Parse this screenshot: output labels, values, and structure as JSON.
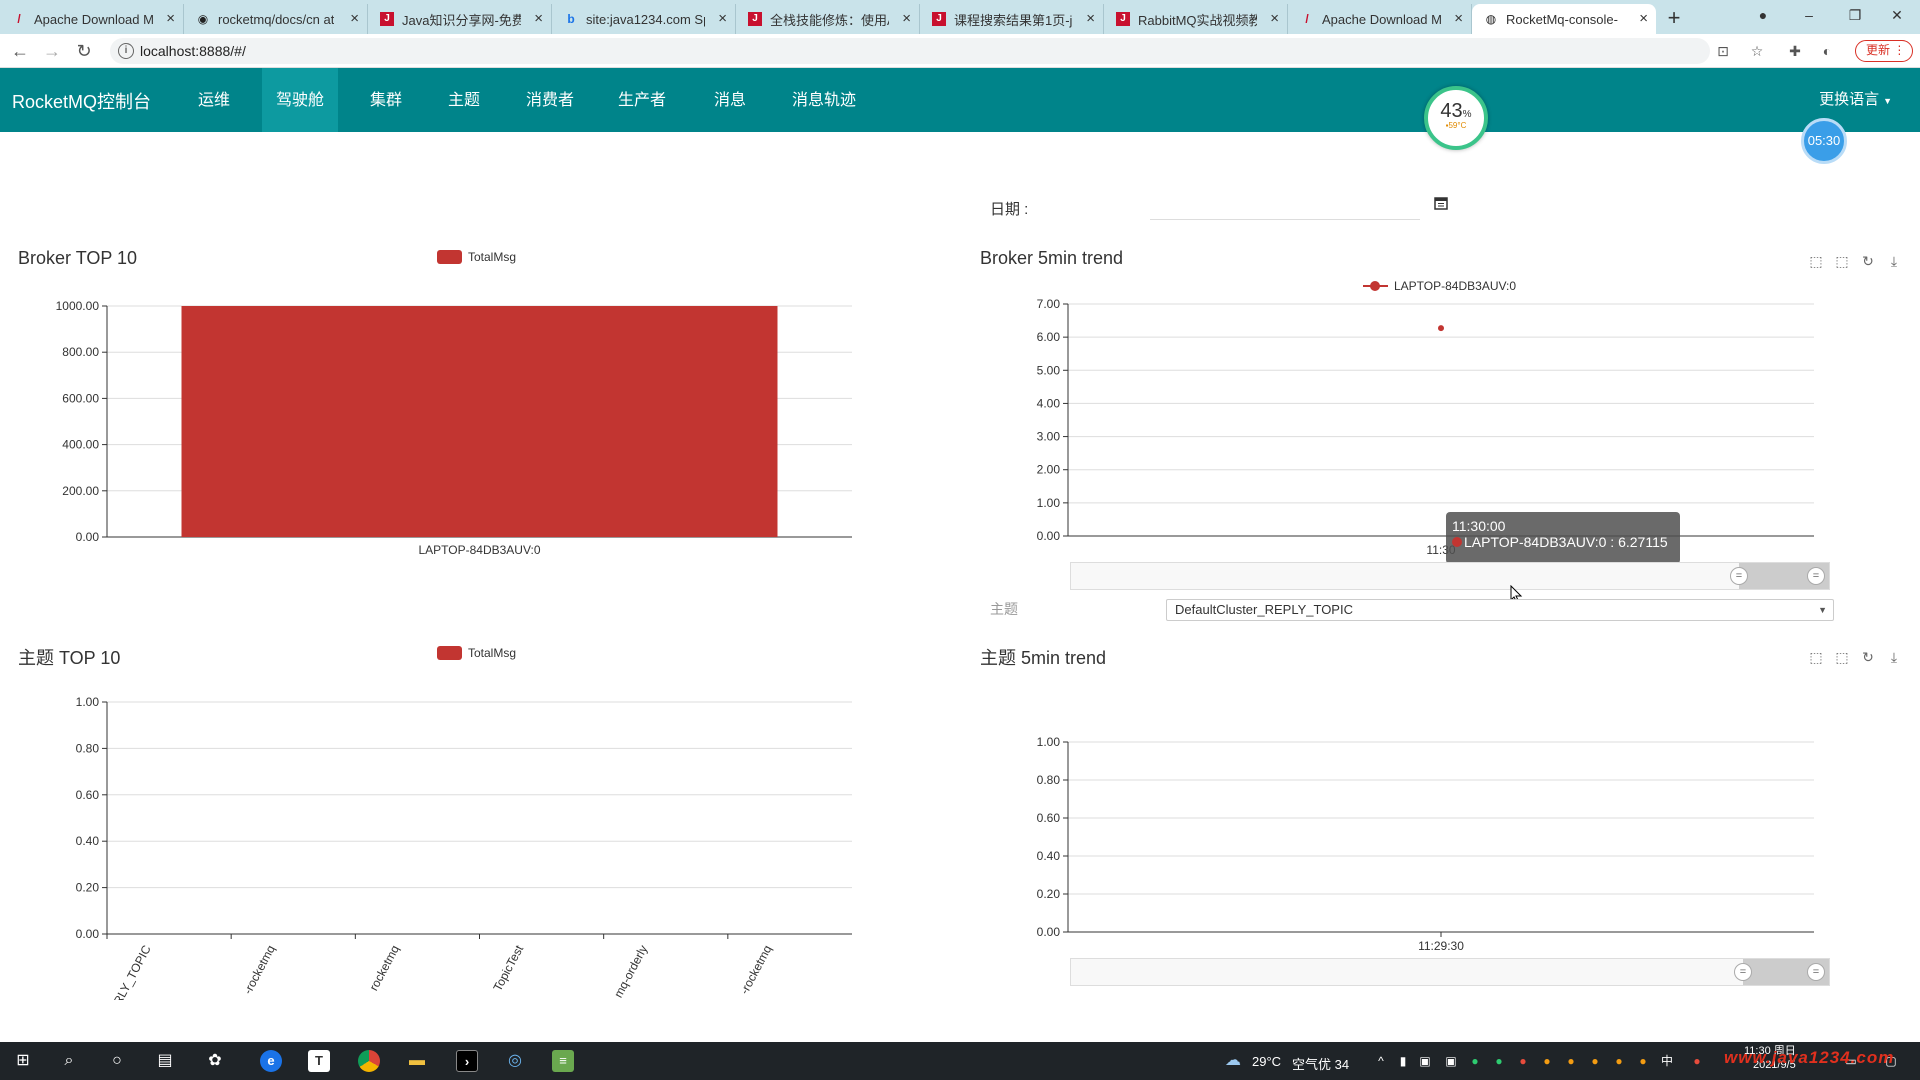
{
  "browser": {
    "tabs": [
      {
        "label": "Apache Download M",
        "icon": "feather-icon",
        "active": false
      },
      {
        "label": "rocketmq/docs/cn at",
        "icon": "github-icon",
        "active": false
      },
      {
        "label": "Java知识分享网-免费",
        "icon": "java1234-icon",
        "active": false
      },
      {
        "label": "site:java1234.com Sp",
        "icon": "bing-icon",
        "active": false
      },
      {
        "label": "全栈技能修炼：使用A",
        "icon": "java1234-icon",
        "active": false
      },
      {
        "label": "课程搜索结果第1页-ja",
        "icon": "java1234-icon",
        "active": false
      },
      {
        "label": "RabbitMQ实战视频教",
        "icon": "java1234-icon",
        "active": false
      },
      {
        "label": "Apache Download M",
        "icon": "feather-icon",
        "active": false
      },
      {
        "label": "RocketMq-console-",
        "icon": "globe-icon",
        "active": true
      }
    ],
    "url": "localhost:8888/#/",
    "update_label": "更新"
  },
  "app": {
    "brand": "RocketMQ控制台",
    "nav": [
      {
        "label": "运维",
        "active": false
      },
      {
        "label": "驾驶舱",
        "active": true
      },
      {
        "label": "集群",
        "active": false
      },
      {
        "label": "主题",
        "active": false
      },
      {
        "label": "消费者",
        "active": false
      },
      {
        "label": "生产者",
        "active": false
      },
      {
        "label": "消息",
        "active": false
      },
      {
        "label": "消息轨迹",
        "active": false
      }
    ],
    "language_label": "更换语言"
  },
  "overlay": {
    "perf_percent": "43",
    "perf_unit": "%",
    "perf_temp": "59°C",
    "clock_badge": "05:30"
  },
  "dashboard": {
    "date_label": "日期 :",
    "date_value": "",
    "topic_label": "主题",
    "topic_selected": "DefaultCluster_REPLY_TOPIC",
    "panels": {
      "broker_top": {
        "title": "Broker TOP 10",
        "legend": "TotalMsg"
      },
      "broker_trend": {
        "title": "Broker 5min trend",
        "legend": "LAPTOP-84DB3AUV:0"
      },
      "topic_top": {
        "title": "主题 TOP 10",
        "legend": "TotalMsg"
      },
      "topic_trend": {
        "title": "主题 5min trend"
      }
    },
    "tooltip": {
      "time": "11:30:00",
      "series": "LAPTOP-84DB3AUV:0",
      "value": "6.27115"
    }
  },
  "chart_data": [
    {
      "type": "bar",
      "title": "Broker TOP 10",
      "categories": [
        "LAPTOP-84DB3AUV:0"
      ],
      "series": [
        {
          "name": "TotalMsg",
          "values": [
            1000
          ]
        }
      ],
      "ylim": [
        0,
        1000
      ],
      "yticks": [
        "0.00",
        "200.00",
        "400.00",
        "600.00",
        "800.00",
        "1000.00"
      ],
      "color": "#c23531"
    },
    {
      "type": "line",
      "title": "Broker 5min trend",
      "x": [
        "11:30"
      ],
      "series": [
        {
          "name": "LAPTOP-84DB3AUV:0",
          "values": [
            6.27115
          ]
        }
      ],
      "ylim": [
        0,
        7
      ],
      "yticks": [
        "0.00",
        "1.00",
        "2.00",
        "3.00",
        "4.00",
        "5.00",
        "6.00",
        "7.00"
      ],
      "color": "#c23531"
    },
    {
      "type": "bar",
      "title": "主题 TOP 10",
      "categories": [
        "RLY_TOPIC",
        "-rocketmq",
        "rocketmq",
        "TopicTest",
        "mq-orderly",
        "-rocketmq"
      ],
      "series": [
        {
          "name": "TotalMsg",
          "values": [
            0,
            0,
            0,
            0,
            0,
            0
          ]
        }
      ],
      "ylim": [
        0,
        1
      ],
      "yticks": [
        "0.00",
        "0.20",
        "0.40",
        "0.60",
        "0.80",
        "1.00"
      ],
      "color": "#c23531"
    },
    {
      "type": "line",
      "title": "主题 5min trend",
      "x": [
        "11:29:30"
      ],
      "series": [],
      "ylim": [
        0,
        1
      ],
      "yticks": [
        "0.00",
        "0.20",
        "0.40",
        "0.60",
        "0.80",
        "1.00"
      ]
    }
  ],
  "taskbar": {
    "weather": "29°C",
    "air": "空气优 34",
    "ime": "中",
    "time": "11:30 周日",
    "date": "2021/9/5",
    "watermark": "www.java1234.com"
  }
}
